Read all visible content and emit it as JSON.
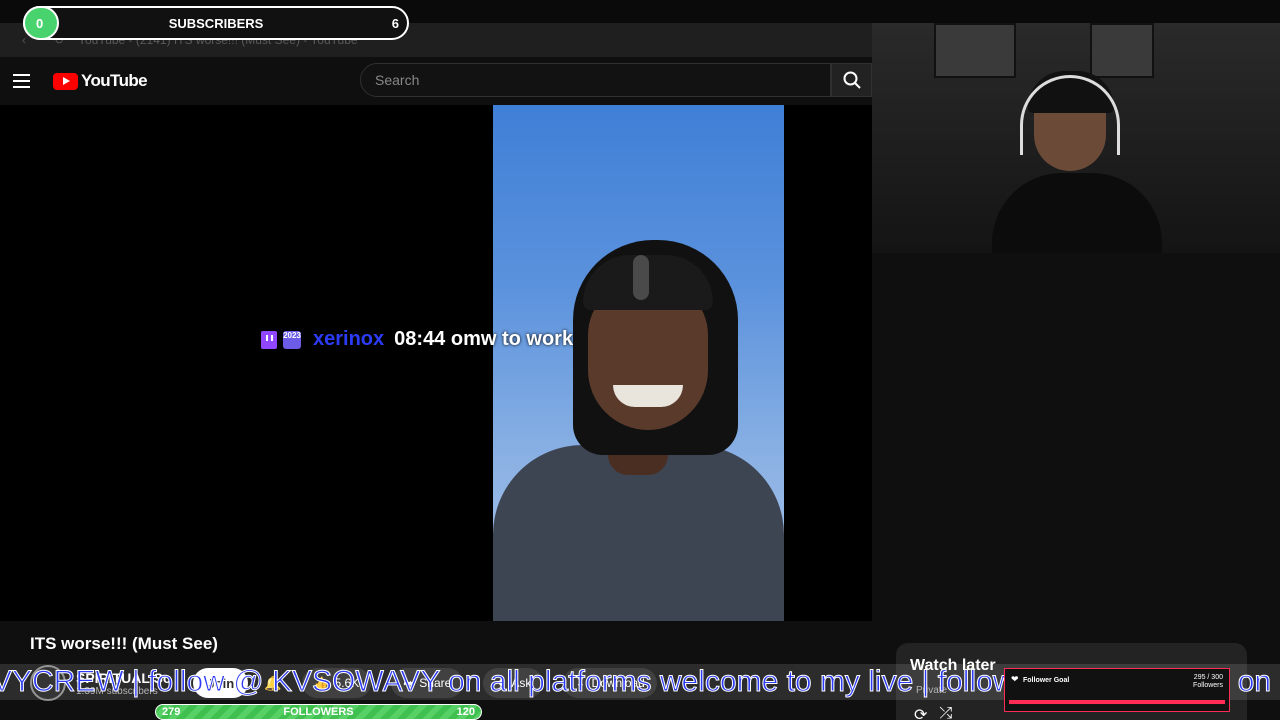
{
  "browser": {
    "tab_title": "YouTube - (2141) ITS worse!!! (Must See) - YouTube"
  },
  "youtube": {
    "logo_text": "YouTube",
    "search_placeholder": "Search"
  },
  "chat_overlay": {
    "badge_text": "2023",
    "username": "xerinox",
    "message": "08:44 omw to work"
  },
  "video": {
    "title": "ITS worse!!! (Must See)",
    "channel_name": "SPIRITUAL So",
    "subscribers": "1.39M subscribers",
    "join_label": "Join",
    "likes": "5.6K",
    "share_label": "Share",
    "ask_label": "Ask",
    "download_label": "Download"
  },
  "subscriber_goal": {
    "current": "0",
    "label": "SUBSCRIBERS",
    "target": "6",
    "progress": 0,
    "fill_color": "#49d36f"
  },
  "followers_goal": {
    "current": "279",
    "label": "FOLLOWERS",
    "target": "120",
    "fill_color": "#40c04f"
  },
  "watch_later": {
    "title": "Watch later",
    "subtitle": "Private"
  },
  "follower_card": {
    "title": "Follower Goal",
    "count": "295 / 300",
    "count_label": "Followers",
    "accent": "#ff2d55"
  },
  "ticker": {
    "text": "VYCREW | follow @ KVSOWAVY on all platforms welcome to my live | follow @ KVSOWAVY on all platforms welcome to my live"
  }
}
